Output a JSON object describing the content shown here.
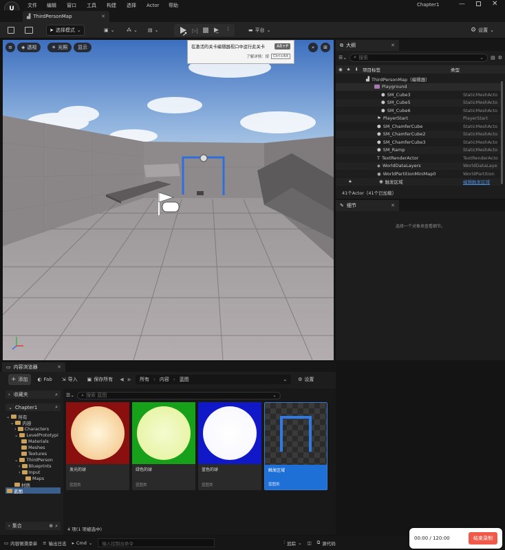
{
  "menu": {
    "items": [
      "文件",
      "编辑",
      "窗口",
      "工具",
      "构建",
      "选择",
      "Actor",
      "帮助"
    ],
    "project": "Chapter1"
  },
  "tab": {
    "label": "ThirdPersonMap"
  },
  "toolbar": {
    "mode_label": "选择模式",
    "platform_label": "平台",
    "settings_label": "设置"
  },
  "tooltip": {
    "title": "在激活的关卡编辑器视口中运行此关卡",
    "shortcut": "Alt+P",
    "more_label": "了解详情：按",
    "more_key": "Ctrl+Alt"
  },
  "viewport": {
    "perspective_label": "透视",
    "lit_label": "光照",
    "show_label": "显示"
  },
  "outliner": {
    "tab_label": "大纲",
    "search_placeholder": "搜索",
    "col_label": "项目标签",
    "col_type": "类型",
    "rows": [
      {
        "name": "ThirdPersonMap（编辑器）",
        "type": ""
      },
      {
        "name": "Playground",
        "type": ""
      },
      {
        "name": "SM_Cube3",
        "type": "StaticMeshActo"
      },
      {
        "name": "SM_Cube5",
        "type": "StaticMeshActo"
      },
      {
        "name": "SM_Cube6",
        "type": "StaticMeshActo"
      },
      {
        "name": "PlayerStart",
        "type": "PlayerStart"
      },
      {
        "name": "SM_ChamferCube",
        "type": "StaticMeshActo"
      },
      {
        "name": "SM_ChamferCube2",
        "type": "StaticMeshActo"
      },
      {
        "name": "SM_ChamferCube3",
        "type": "StaticMeshActo"
      },
      {
        "name": "SM_Ramp",
        "type": "StaticMeshActo"
      },
      {
        "name": "TextRenderActor",
        "type": "TextRenderActo"
      },
      {
        "name": "WorldDataLayers",
        "type": "WorldDataLaye"
      },
      {
        "name": "WorldPartitionMiniMap0",
        "type": "WorldPartition"
      },
      {
        "name": "触发区域",
        "type": "编辑触发区域"
      }
    ],
    "footer": "41个Actor（41个已加载）"
  },
  "details": {
    "tab_label": "细节",
    "empty_text": "选择一个对象来查看细节。"
  },
  "content_browser": {
    "tab_label": "内容浏览器",
    "add_label": "添加",
    "fab_label": "Fab",
    "import_label": "导入",
    "save_all_label": "保存所有",
    "breadcrumb": [
      "所有",
      "内容",
      "蓝图"
    ],
    "settings_label": "设置",
    "favorites_label": "收藏夹",
    "project_label": "Chapter1",
    "search_placeholder": "搜索 蓝图",
    "tree": [
      "所有",
      "内容",
      "Characters",
      "LevelPrototypi",
      "Materials",
      "Meshes",
      "Textures",
      "ThirdPerson",
      "Blueprints",
      "Input",
      "Maps",
      "材质",
      "蓝图"
    ],
    "collections_label": "集合",
    "assets": [
      {
        "name": "发光的球",
        "type": "蓝图类",
        "color": "#f2c9a0"
      },
      {
        "name": "绿色的球",
        "type": "蓝图类",
        "color": "#e8f5b0"
      },
      {
        "name": "蓝色的球",
        "type": "蓝图类",
        "color": "#ffffff"
      },
      {
        "name": "触发区域",
        "type": "蓝图类",
        "color": "#3a7bd5"
      }
    ],
    "status": "4 项(1 项被选中)"
  },
  "bottom_bar": {
    "drawer_label": "内容侧滑菜单",
    "log_label": "输出日志",
    "cmd_label": "Cmd",
    "console_placeholder": "输入控制台命令",
    "trace_label": "追踪",
    "source_label": "源代码"
  },
  "recording": {
    "time": "00:00 / 120:00",
    "stop_label": "结束录制"
  }
}
